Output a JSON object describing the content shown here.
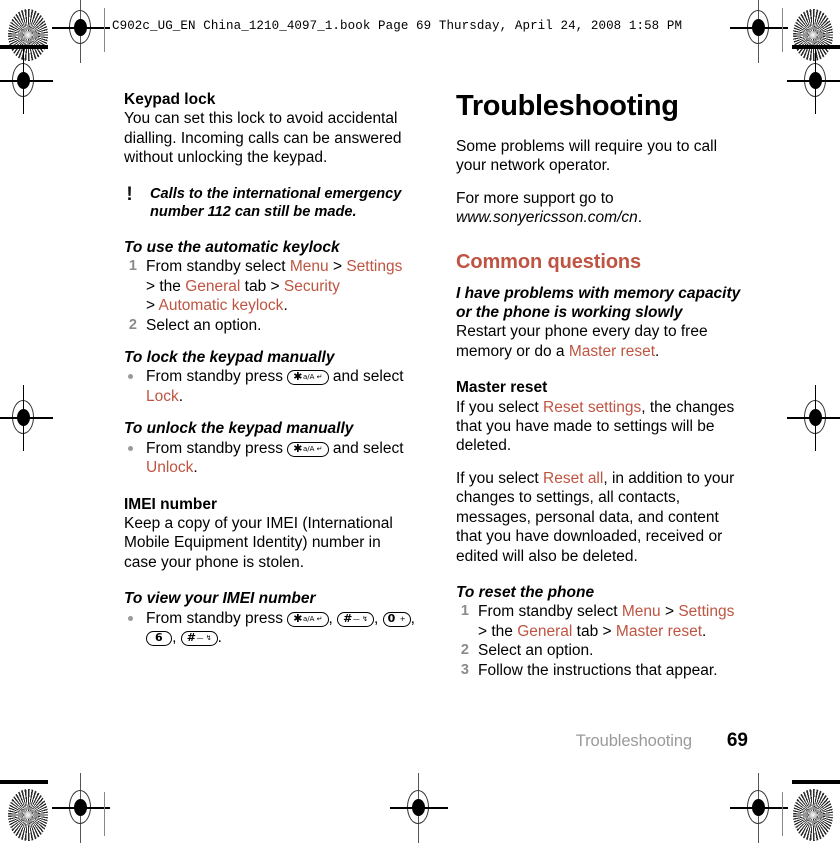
{
  "print_slug": "C902c_UG_EN China_1210_4097_1.book  Page 69  Thursday, April 24, 2008  1:58 PM",
  "colors": {
    "accent": "#BE5441",
    "muted": "#9A9A9A",
    "text": "#000000"
  },
  "left_column": {
    "heading": "Keypad lock",
    "intro": "You can set this lock to avoid accidental dialling. Incoming calls can be answered without unlocking the keypad.",
    "note": {
      "icon": "exclamation-icon",
      "text": "Calls to the international emergency number 112 can still be made."
    },
    "proc_keylock": {
      "title": "To use the automatic keylock",
      "steps": [
        {
          "num": "1",
          "parts": [
            {
              "t": "From standby select ",
              "style": "plain"
            },
            {
              "t": "Menu",
              "style": "link"
            },
            {
              "t": " > ",
              "style": "plain"
            },
            {
              "t": "Settings",
              "style": "link"
            },
            {
              "t": " > the ",
              "style": "plain"
            },
            {
              "t": "General",
              "style": "link"
            },
            {
              "t": " tab > ",
              "style": "plain"
            },
            {
              "t": "Security",
              "style": "link"
            },
            {
              "t": " > ",
              "style": "plain"
            },
            {
              "t": "Automatic keylock",
              "style": "link"
            },
            {
              "t": ".",
              "style": "plain"
            }
          ]
        },
        {
          "num": "2",
          "parts": [
            {
              "t": "Select an option.",
              "style": "plain"
            }
          ]
        }
      ]
    },
    "proc_lock": {
      "title": "To lock the keypad manually",
      "bullet_pre": "From standby press ",
      "key": {
        "main": "✱",
        "mini": "a/A ↵"
      },
      "bullet_mid": " and select ",
      "bullet_link": "Lock",
      "bullet_end": "."
    },
    "proc_unlock": {
      "title": "To unlock the keypad manually",
      "bullet_pre": "From standby press ",
      "key": {
        "main": "✱",
        "mini": "a/A ↵"
      },
      "bullet_mid": " and select ",
      "bullet_link": "Unlock",
      "bullet_end": "."
    },
    "imei": {
      "heading": "IMEI number",
      "body": "Keep a copy of your IMEI (International Mobile Equipment Identity) number in case your phone is stolen."
    },
    "proc_imei": {
      "title": "To view your IMEI number",
      "bullet_pre": "From standby press ",
      "keys": [
        {
          "main": "✱",
          "mini": "a/A ↵"
        },
        {
          "main": "#",
          "mini": "— ↯"
        },
        {
          "main": "0",
          "mini": "+"
        },
        {
          "main": "6",
          "mini": ""
        },
        {
          "main": "#",
          "mini": "— ↯"
        }
      ],
      "separator": ", ",
      "bullet_end": "."
    }
  },
  "right_column": {
    "chapter_title": "Troubleshooting",
    "intro1": "Some problems will require you to call your network operator.",
    "intro2_pre": "For more support go to ",
    "intro2_url": "www.sonyericsson.com/cn",
    "intro2_end": ".",
    "section_title": "Common questions",
    "q_memory": {
      "title": "I have problems with memory capacity or the phone is working slowly",
      "answer_pre": "Restart your phone every day to free memory or do a ",
      "answer_link": "Master reset",
      "answer_end": "."
    },
    "master_reset": {
      "heading": "Master reset",
      "p1_pre": "If you select ",
      "p1_link": "Reset settings",
      "p1_end": ", the changes that you have made to settings will be deleted.",
      "p2_pre": "If you select ",
      "p2_link": "Reset all",
      "p2_end": ", in addition to your changes to settings, all contacts, messages, personal data, and content that you have downloaded, received or edited will also be deleted."
    },
    "proc_reset": {
      "title": "To reset the phone",
      "steps": [
        {
          "num": "1",
          "parts": [
            {
              "t": "From standby select ",
              "style": "plain"
            },
            {
              "t": "Menu",
              "style": "link"
            },
            {
              "t": " > ",
              "style": "plain"
            },
            {
              "t": "Settings",
              "style": "link"
            },
            {
              "t": " > the ",
              "style": "plain"
            },
            {
              "t": "General",
              "style": "link"
            },
            {
              "t": " tab > ",
              "style": "plain"
            },
            {
              "t": "Master reset",
              "style": "link"
            },
            {
              "t": ".",
              "style": "plain"
            }
          ]
        },
        {
          "num": "2",
          "parts": [
            {
              "t": "Select an option.",
              "style": "plain"
            }
          ]
        },
        {
          "num": "3",
          "parts": [
            {
              "t": "Follow the instructions that appear.",
              "style": "plain"
            }
          ]
        }
      ]
    }
  },
  "footer": {
    "chapter": "Troubleshooting",
    "page_number": "69"
  }
}
